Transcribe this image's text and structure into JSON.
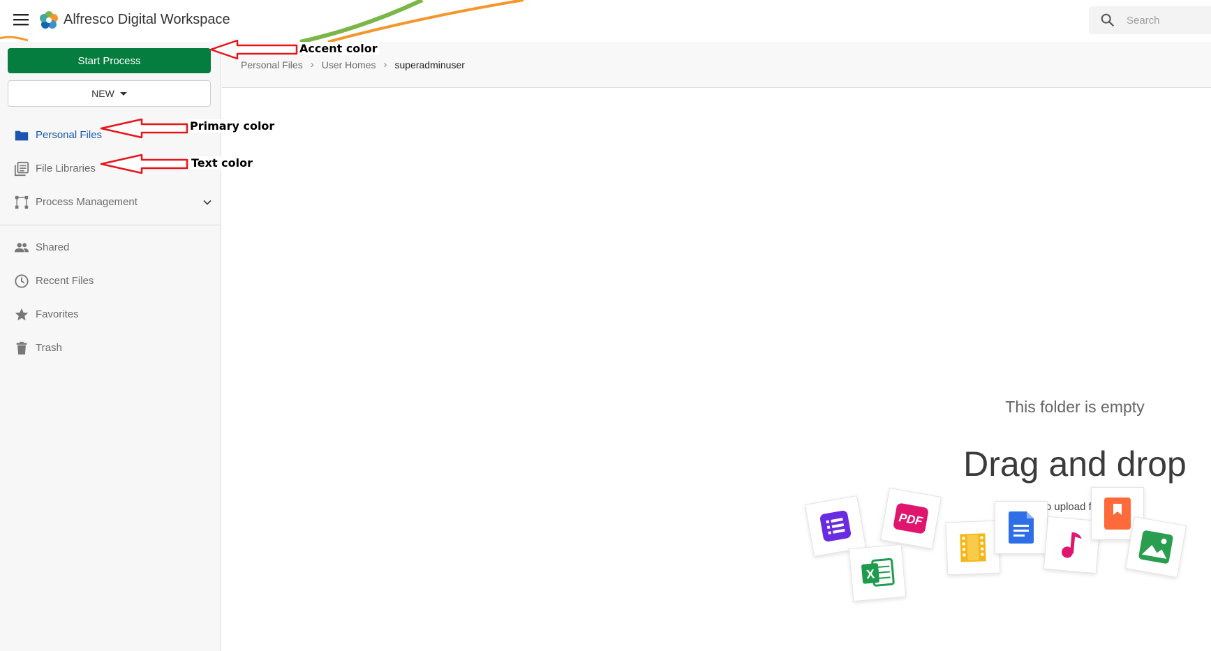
{
  "header": {
    "app_title": "Alfresco Digital Workspace",
    "menu_icon": "hamburger-menu-icon",
    "logo_icon": "alfresco-flower-logo",
    "search": {
      "placeholder": "Search",
      "icon": "search-icon"
    }
  },
  "sidebar": {
    "start_process_label": "Start Process",
    "new_label": "NEW",
    "items": [
      {
        "label": "Personal Files",
        "icon": "folder-icon",
        "active": true
      },
      {
        "label": "File Libraries",
        "icon": "library-icon",
        "active": false
      },
      {
        "label": "Process Management",
        "icon": "process-icon",
        "active": false,
        "expandable": true
      },
      {
        "label": "Shared",
        "icon": "people-icon",
        "active": false
      },
      {
        "label": "Recent Files",
        "icon": "clock-icon",
        "active": false
      },
      {
        "label": "Favorites",
        "icon": "star-icon",
        "active": false
      },
      {
        "label": "Trash",
        "icon": "trash-icon",
        "active": false
      }
    ]
  },
  "breadcrumb": {
    "items": [
      "Personal Files",
      "User Homes"
    ],
    "current": "superadminuser",
    "separator": "›"
  },
  "empty_state": {
    "message": "This folder is empty",
    "title": "Drag and drop",
    "subtitle": "to upload files",
    "file_icons": [
      "list-doc-icon",
      "pdf-icon",
      "excel-icon",
      "film-icon",
      "doc-icon",
      "music-icon",
      "bookmark-icon",
      "image-icon"
    ]
  },
  "annotations": {
    "accent": "Accent color",
    "primary": "Primary color",
    "text": "Text color"
  },
  "colors": {
    "accent": "#047d3f",
    "primary": "#1a56b0",
    "text": "#6b6b6b",
    "annotation_arrow": "#e8141c"
  }
}
